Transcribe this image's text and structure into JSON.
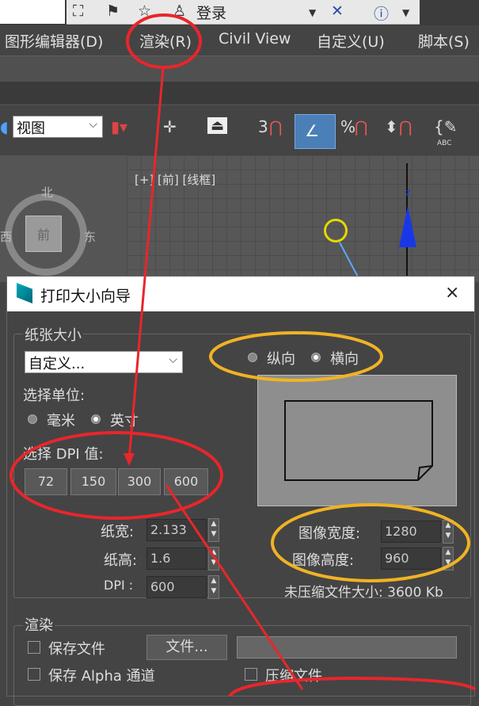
{
  "top_toolbar": {
    "login_label": "登录"
  },
  "menubar": {
    "items": [
      {
        "label": "图形编辑器(D)"
      },
      {
        "label": "渲染(R)"
      },
      {
        "label": "Civil View"
      },
      {
        "label": "自定义(U)"
      },
      {
        "label": "脚本(S)"
      }
    ]
  },
  "toolbar": {
    "view_select_value": "视图",
    "snap_count": "3",
    "percent_snap": "%",
    "abc_label": "ABC"
  },
  "viewport": {
    "label": "[+] [前] [线框]",
    "viewcube_north": "北",
    "viewcube_east": "东",
    "viewcube_west": "西",
    "viewcube_face": "前",
    "axis_z": "z"
  },
  "dialog": {
    "title": "打印大小向导",
    "close_glyph": "×",
    "paper_group_label": "纸张大小",
    "paper_select_value": "自定义...",
    "unit_label": "选择单位:",
    "unit_options": [
      {
        "label": "毫米",
        "selected": false
      },
      {
        "label": "英寸",
        "selected": true
      }
    ],
    "dpi_label": "选择 DPI 值:",
    "dpi_buttons": [
      "72",
      "150",
      "300",
      "600"
    ],
    "orientation_options": [
      {
        "label": "纵向",
        "selected": false
      },
      {
        "label": "横向",
        "selected": true
      }
    ],
    "paper_width_label": "纸宽:",
    "paper_width_value": "2.133",
    "paper_height_label": "纸高:",
    "paper_height_value": "1.6",
    "dpi_field_label": "DPI :",
    "dpi_field_value": "600",
    "image_width_label": "图像宽度:",
    "image_width_value": "1280",
    "image_height_label": "图像高度:",
    "image_height_value": "960",
    "file_size_text": "未压缩文件大小: 3600 Kb",
    "render_group_label": "渲染",
    "save_file_label": "保存文件",
    "file_button_label": "文件...",
    "save_alpha_label": "保存 Alpha 通道",
    "compress_label": "压缩文件"
  },
  "annotation_colors": {
    "red": "#e8262b",
    "orange": "#f0b323"
  }
}
